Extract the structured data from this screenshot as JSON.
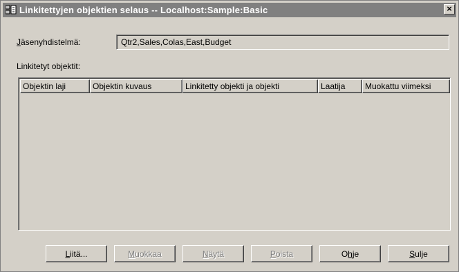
{
  "window": {
    "title": "Linkitettyjen objektien selaus  -- Localhost:Sample:Basic",
    "close_label": "×"
  },
  "member_combination": {
    "label": "Jäsenyhdistelmä:",
    "value": "Qtr2,Sales,Colas,East,Budget"
  },
  "linked_objects": {
    "label": "Linkitetyt objektit:",
    "columns": [
      "Objektin laji",
      "Objektin kuvaus",
      "Linkitetty objekti ja objekti",
      "Laatija",
      "Muokattu viimeksi"
    ],
    "rows": []
  },
  "buttons": [
    {
      "label": "Liitä...",
      "enabled": true
    },
    {
      "label": "Muokkaa",
      "enabled": false
    },
    {
      "label": "Näytä",
      "enabled": false
    },
    {
      "label": "Poista",
      "enabled": false
    },
    {
      "label": "Ohje",
      "enabled": true
    },
    {
      "label": "Sulje",
      "enabled": true
    }
  ],
  "colors": {
    "title_bar": "#808080",
    "dialog_face": "#d4d0c8",
    "disabled_text": "#808080"
  }
}
